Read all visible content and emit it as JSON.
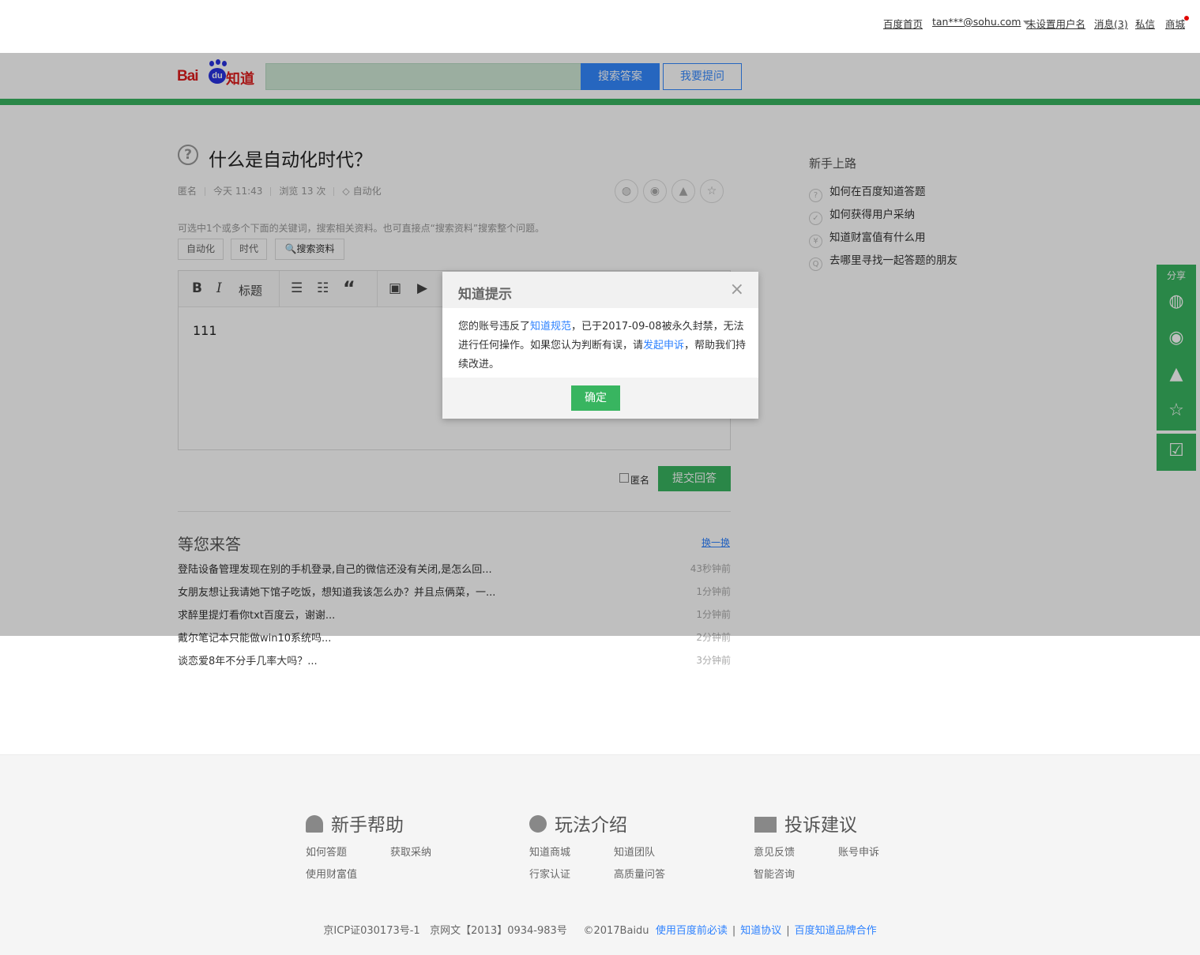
{
  "topbar": {
    "home": "百度首页",
    "user": "tan***@sohu.com",
    "set_name": "未设置用户名",
    "messages": "消息(3)",
    "private_msg": "私信",
    "store": "商城"
  },
  "header": {
    "logo_bai": "Bai",
    "logo_du": "du",
    "logo_zhidao": "知道",
    "search_placeholder": "",
    "search_button": "搜索答案",
    "ask_button": "我要提问"
  },
  "question": {
    "icon": "?",
    "title": "什么是自动化时代？",
    "author": "匿名",
    "time": "今天 11:43",
    "views": "浏览 13 次",
    "tag": "自动化",
    "keyword_hint": "可选中1个或多个下面的关键词，搜索相关资料。也可直接点“搜索资料”搜索整个问题。",
    "keywords": [
      "自动化",
      "时代"
    ],
    "search_material": "搜索资料"
  },
  "editor": {
    "bold": "B",
    "italic": "I",
    "heading": "标题",
    "quote": "“",
    "content": "111"
  },
  "answer": {
    "anonymous": "匿名",
    "submit": "提交回答"
  },
  "waiting": {
    "title": "等您来答",
    "refresh": "换一换",
    "items": [
      {
        "q": "登陆设备管理发现在别的手机登录,自己的微信还没有关闭,是怎么回...",
        "t": "43秒钟前"
      },
      {
        "q": "女朋友想让我请她下馆子吃饭，想知道我该怎么办？并且点俩菜，一...",
        "t": "1分钟前"
      },
      {
        "q": "求醉里提灯看你txt百度云，谢谢...",
        "t": "1分钟前"
      },
      {
        "q": "戴尔笔记本只能做win10系统吗...",
        "t": "2分钟前"
      },
      {
        "q": "谈恋爱8年不分手几率大吗？...",
        "t": "3分钟前"
      }
    ]
  },
  "sidebar": {
    "title": "新手上路",
    "items": [
      {
        "icon": "?",
        "label": "如何在百度知道答题"
      },
      {
        "icon": "✓",
        "label": "如何获得用户采纳"
      },
      {
        "icon": "¥",
        "label": "知道财富值有什么用"
      },
      {
        "icon": "Q",
        "label": "去哪里寻找一起答题的朋友"
      }
    ]
  },
  "share_panel": {
    "label": "分享"
  },
  "dialog": {
    "title": "知道提示",
    "close": "×",
    "text1": "您的账号违反了",
    "link1": "知道规范",
    "text2": "，已于2017-09-08被永久封禁，无法进行任何操作。如果您认为判断有误，请",
    "link2": "发起申诉",
    "text3": "，帮助我们持续改进。",
    "ok": "确定"
  },
  "footer": {
    "col1": {
      "title": "新手帮助",
      "links": [
        "如何答题",
        "获取采纳",
        "使用财富值"
      ]
    },
    "col2": {
      "title": "玩法介绍",
      "links": [
        "知道商城",
        "知道团队",
        "行家认证",
        "高质量问答"
      ]
    },
    "col3": {
      "title": "投诉建议",
      "links": [
        "意见反馈",
        "账号申诉",
        "智能咨询"
      ]
    },
    "icp": "京ICP证030173号-1",
    "wenhua": "京网文【2013】0934-983号",
    "copyright": "©2017Baidu",
    "link_a": "使用百度前必读",
    "link_b": "知道协议",
    "link_c": "百度知道品牌合作"
  },
  "colors": {
    "green": "#38b560",
    "blue": "#2e82ff",
    "overlay": "rgba(0,0,0,0.25)"
  }
}
